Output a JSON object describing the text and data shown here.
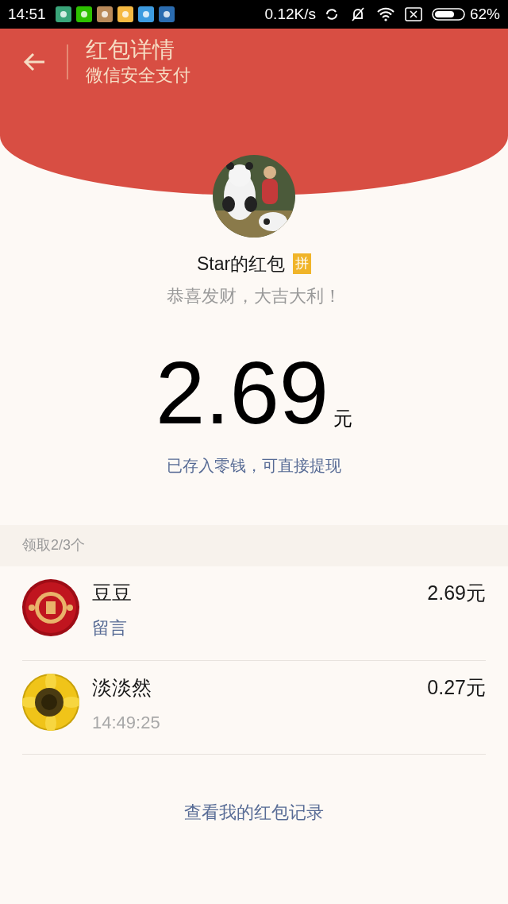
{
  "status_bar": {
    "time": "14:51",
    "network_speed": "0.12K/s",
    "battery": "62%"
  },
  "header": {
    "title": "红包详情",
    "subtitle": "微信安全支付"
  },
  "sender": {
    "name": "Star的红包",
    "badge": "拼",
    "greeting": "恭喜发财，大吉大利！"
  },
  "amount": {
    "value": "2.69",
    "unit": "元",
    "note": "已存入零钱，可直接提现"
  },
  "summary": "领取2/3个",
  "recipients": [
    {
      "name": "豆豆",
      "amount": "2.69元",
      "detail": "留言",
      "kind": "link"
    },
    {
      "name": "淡淡然",
      "amount": "0.27元",
      "detail": "14:49:25",
      "kind": "time"
    }
  ],
  "footer_link": "查看我的红包记录"
}
